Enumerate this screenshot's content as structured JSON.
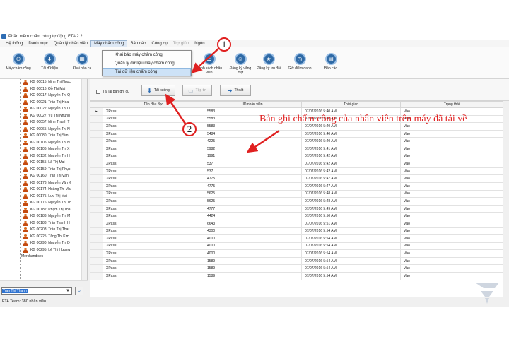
{
  "window": {
    "title": "Phần mềm chấm công tự động FTA 2.2"
  },
  "menu": [
    {
      "label": "Hệ thống",
      "state": "normal"
    },
    {
      "label": "Danh mục",
      "state": "normal"
    },
    {
      "label": "Quản lý nhân viên",
      "state": "normal"
    },
    {
      "label": "Máy chấm công",
      "state": "active"
    },
    {
      "label": "Báo cáo",
      "state": "normal"
    },
    {
      "label": "Công cụ",
      "state": "normal"
    },
    {
      "label": "Trợ giúp",
      "state": "disabled"
    },
    {
      "label": "Ngôn",
      "state": "normal"
    }
  ],
  "dropdown": [
    {
      "label": "Khai báo máy chấm công",
      "highlighted": false
    },
    {
      "label": "Quản lý dữ liệu máy chấm công",
      "highlighted": false
    },
    {
      "label": "Tải dữ liệu chấm công",
      "highlighted": true
    }
  ],
  "toolbar": [
    {
      "label": "Máy chấm công",
      "icon": "time-clock-icon",
      "glyph": "⏲"
    },
    {
      "label": "Tải dữ liệu",
      "icon": "download-icon",
      "glyph": "⬇"
    },
    {
      "label": "Khai báo ca",
      "icon": "calendar-icon",
      "glyph": "▦"
    },
    {
      "label": "Danh sách nhân viên",
      "icon": "staff-list-icon",
      "glyph": "☰"
    },
    {
      "label": "Đăng ký vắng mặt",
      "icon": "absence-icon",
      "glyph": "☺"
    },
    {
      "label": "Đăng ký ưu đãi",
      "icon": "benefit-icon",
      "glyph": "★"
    },
    {
      "label": "Giờ điểm danh",
      "icon": "checkin-time-icon",
      "glyph": "◷"
    },
    {
      "label": "Báo cáo",
      "icon": "report-icon",
      "glyph": "▤"
    }
  ],
  "employees": [
    "KG 00015: Ninh Thị Ngọc",
    "KG 00016: Đỗ Thị Mai",
    "KG 00017: Nguyễn Thị Q",
    "KG 00021: Trần Thị Hoa",
    "KG 00022: Nguyễn Thị D",
    "KG 00027: Vũ Thị Nhung",
    "KG 00057: Ninh Thanh T",
    "KG 00065: Nguyễn Thị N",
    "KG 00080: Trần Thị Sim",
    "KG 00105: Nguyễn Thị N",
    "KG 00106: Nguyễn Thị X",
    "KG 00132: Nguyễn Thị H",
    "KG 00155: Lã Thị Mai",
    "KG 00159: Trần Thị Phục",
    "KG 00160: Trần Thị Vân",
    "KG 00173: Nguyễn Văn K",
    "KG 00174: Hoàng Thị Ma",
    "KG 00175: Lưu Thị Mai",
    "KG 00176: Nguyễn Thị Th",
    "KG 00182: Phạm Thị Tha",
    "KG 00183: Nguyễn Thị M",
    "KG 00188: Trần Thanh H",
    "KG 00208: Trần Thị Thar",
    "KG 00225: Tăng Thị Kim",
    "KG 00290: Nguyễn Thị D",
    "KG 00295: Lê Thị Hương"
  ],
  "tree_folder": "Merchandises",
  "search": {
    "value": "Tran Thi Thanh"
  },
  "status": "FTA Team: 380 nhân viên",
  "actions": {
    "checkbox_label": "Tải lại bản ghi cũ",
    "download": "Tải xuống",
    "filter": "Tệp tin",
    "exit": "Thoát"
  },
  "grid": {
    "columns": [
      "Tên đầu đọc",
      "ID nhân viên",
      "Thời gian",
      "Trạng thái"
    ],
    "rows": [
      {
        "reader": "XPass",
        "id": "5583",
        "time": "07/07/2016 5:40 AM",
        "status": "Vào"
      },
      {
        "reader": "XPass",
        "id": "5583",
        "time": "07/07/2016 5:40 AM",
        "status": "Vào"
      },
      {
        "reader": "XPass",
        "id": "5583",
        "time": "07/07/2016 5:40 AM",
        "status": "Vào"
      },
      {
        "reader": "XPass",
        "id": "5484",
        "time": "07/07/2016 5:40 AM",
        "status": "Vào"
      },
      {
        "reader": "XPass",
        "id": "4225",
        "time": "07/07/2016 5:40 AM",
        "status": "Vào"
      },
      {
        "reader": "XPass",
        "id": "5982",
        "time": "07/07/2016 5:41 AM",
        "status": "Vào"
      },
      {
        "reader": "XPass",
        "id": "1991",
        "time": "07/07/2016 5:42 AM",
        "status": "Vào"
      },
      {
        "reader": "XPass",
        "id": "537",
        "time": "07/07/2016 5:42 AM",
        "status": "Vào"
      },
      {
        "reader": "XPass",
        "id": "537",
        "time": "07/07/2016 5:42 AM",
        "status": "Vào"
      },
      {
        "reader": "XPass",
        "id": "4775",
        "time": "07/07/2016 5:47 AM",
        "status": "Vào"
      },
      {
        "reader": "XPass",
        "id": "4775",
        "time": "07/07/2016 5:47 AM",
        "status": "Vào"
      },
      {
        "reader": "XPass",
        "id": "5625",
        "time": "07/07/2016 5:48 AM",
        "status": "Vào"
      },
      {
        "reader": "XPass",
        "id": "5625",
        "time": "07/07/2016 5:48 AM",
        "status": "Vào"
      },
      {
        "reader": "XPass",
        "id": "4777",
        "time": "07/07/2016 5:49 AM",
        "status": "Vào"
      },
      {
        "reader": "XPass",
        "id": "4424",
        "time": "07/07/2016 5:50 AM",
        "status": "Vào"
      },
      {
        "reader": "XPass",
        "id": "6643",
        "time": "07/07/2016 5:51 AM",
        "status": "Vào"
      },
      {
        "reader": "XPass",
        "id": "4300",
        "time": "07/07/2016 5:54 AM",
        "status": "Vào"
      },
      {
        "reader": "XPass",
        "id": "4000",
        "time": "07/07/2016 5:54 AM",
        "status": "Vào"
      },
      {
        "reader": "XPass",
        "id": "4000",
        "time": "07/07/2016 5:54 AM",
        "status": "Vào"
      },
      {
        "reader": "XPass",
        "id": "4000",
        "time": "07/07/2016 5:54 AM",
        "status": "Vào"
      },
      {
        "reader": "XPass",
        "id": "1589",
        "time": "07/07/2016 5:54 AM",
        "status": "Vào"
      },
      {
        "reader": "XPass",
        "id": "1589",
        "time": "07/07/2016 5:54 AM",
        "status": "Vào"
      },
      {
        "reader": "XPass",
        "id": "1589",
        "time": "07/07/2016 5:54 AM",
        "status": "Vào"
      }
    ],
    "selected_row": 0,
    "highlighted_row": 5
  },
  "annotation": {
    "text": "Bản ghi chấm công của nhân viên trên máy đã tải về",
    "step1": "1",
    "step2": "2",
    "color": "#e02020"
  }
}
